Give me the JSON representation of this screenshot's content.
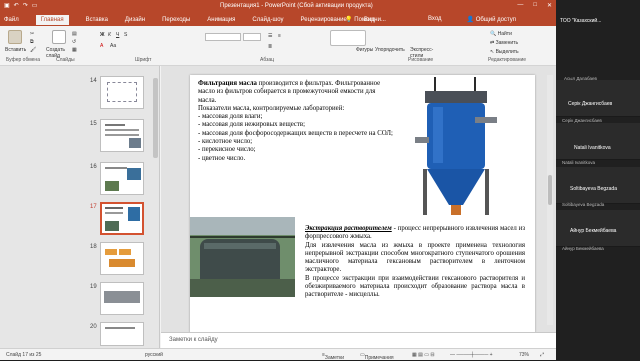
{
  "window": {
    "title": "Презентация1 - PowerPoint (Сбой активации продукта)",
    "controls": [
      "—",
      "□",
      "✕"
    ]
  },
  "tabs": {
    "items": [
      "Файл",
      "Главная",
      "Вставка",
      "Дизайн",
      "Переходы",
      "Анимация",
      "Слайд-шоу",
      "Рецензирование",
      "Вид"
    ],
    "active_index": 1,
    "help": "Помощни...",
    "signin": "Вход",
    "share": "Общий доступ"
  },
  "ribbon": {
    "paste": "Вставить",
    "create_slide": "Создать слайд",
    "clipboard": "Буфер обмена",
    "slides": "Слайды",
    "font": "Шрифт",
    "paragraph": "Абзац",
    "figures": "Фигуры",
    "arrange": "Упорядочить",
    "express": "Экспресс-стили",
    "drawing": "Рисование",
    "find": "Найти",
    "replace": "Заменить",
    "select": "Выделить",
    "editing": "Редактирование"
  },
  "thumbnails": {
    "numbers": [
      "14",
      "15",
      "16",
      "17",
      "18",
      "19",
      "20"
    ],
    "selected": "17"
  },
  "slide": {
    "text1_bold": "Фильтрация масла",
    "text1_rest": " производится в фильтрах. Фильтрованное масло из фильтров собирается в промежуточной емкости для масла.",
    "text1_lines": [
      "Показатели масла, контролируемые лабораторией:",
      "- массовая доля влаги;",
      "- массовая доля нежировых веществ;",
      "- массовая доля фосфоросодержащих веществ в пересчете на СОЛ;",
      "- кислотное число;",
      "- перекисное число;",
      "- цветное число."
    ],
    "text2_bold": "Экстракция растворителем",
    "text2_p1": " - процесс непрерывного извлечения масел из форпрессового жмыха.",
    "text2_p2": "Для извлечения масла из жмыха в проекте применена технология непрерывной экстракции способом многократного ступенчатого орошения масличного материала гексановым растворителем в ленточном экстракторе.",
    "text2_p3": "В процессе экстракции при взаимодействии гексанового растворителя и обезжириваемого материала происходит образование раствора масла в растворителе - мисцеллы."
  },
  "notes": {
    "placeholder": "Заметки к слайду"
  },
  "status": {
    "slide": "Слайд 17 из 25",
    "lang": "русский",
    "notes": "Заметки",
    "comments": "Примечания",
    "zoom": "73%"
  },
  "participants": [
    {
      "name": "ТОО \"Казахский...",
      "sub": ""
    },
    {
      "name": "",
      "sub": "Асыл Далабаев"
    },
    {
      "name": "Серік Джангисбаев",
      "sub": "Серік Джангисбаев"
    },
    {
      "name": "Natali Ivanitkova",
      "sub": "Natali Ivanitkova"
    },
    {
      "name": "Soltibayeva Begzada",
      "sub": "Soltibayeva Begzada"
    },
    {
      "name": "Айнур Бекмейбаева",
      "sub": "Айнур Бекмейбаева"
    }
  ],
  "colors": {
    "accent": "#b7472a",
    "selected_thumb": "#d35230"
  }
}
